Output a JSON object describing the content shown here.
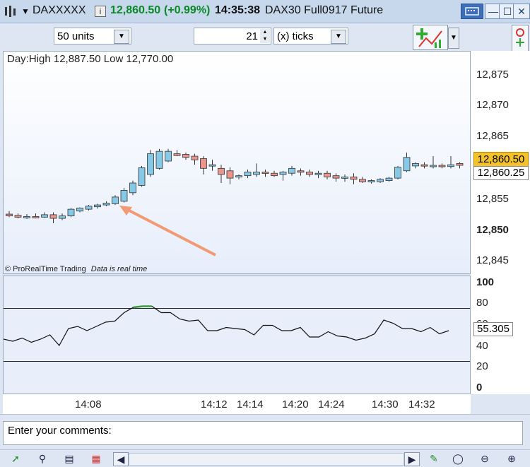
{
  "title": {
    "symbol": "DAXXXXX",
    "price": "12,860.50",
    "change": "(+0.99%)",
    "time": "14:35:38",
    "instrument": "DAX30 Full0917 Future",
    "info_glyph": "i",
    "minimize_glyph": "—",
    "maximize_glyph": "☐",
    "close_glyph": "✕",
    "keyboard_icon": "keyboard-icon"
  },
  "toolbar": {
    "units_value": "50 units",
    "ticks_value": "21",
    "ticks_unit": "(x) ticks"
  },
  "chart": {
    "header": "Day:High 12,887.50 Low 12,770.00",
    "credit": "© ProRealTime Trading",
    "credit_note": "Data is real time",
    "y_ticks": [
      "12,875",
      "12,870",
      "12,865",
      "12,860",
      "12,855",
      "12,850",
      "12,845"
    ],
    "price_badge": "12,860.50",
    "price_badge2": "12,860.25",
    "candle_up_color": "#86c9e6",
    "candle_down_color": "#e8958c",
    "arrow_color": "#f29a74"
  },
  "rsi": {
    "y_ticks": [
      "100",
      "80",
      "60",
      "40",
      "20",
      "0"
    ],
    "value_badge": "55.305"
  },
  "x_ticks": [
    "14:08",
    "14:12",
    "14:14",
    "14:20",
    "14:24",
    "14:30",
    "14:32"
  ],
  "comments": {
    "placeholder": "Enter your comments:"
  },
  "chart_data": {
    "type": "candlestick",
    "ohlc": [
      {
        "o": 12852.5,
        "h": 12853.0,
        "l": 12852.0,
        "c": 12852.2
      },
      {
        "o": 12852.3,
        "h": 12852.6,
        "l": 12851.8,
        "c": 12852.0
      },
      {
        "o": 12852.0,
        "h": 12852.5,
        "l": 12851.7,
        "c": 12852.1
      },
      {
        "o": 12852.1,
        "h": 12852.6,
        "l": 12851.8,
        "c": 12852.0
      },
      {
        "o": 12852.0,
        "h": 12852.8,
        "l": 12851.9,
        "c": 12852.4
      },
      {
        "o": 12852.4,
        "h": 12852.8,
        "l": 12851.0,
        "c": 12851.8
      },
      {
        "o": 12851.8,
        "h": 12852.6,
        "l": 12851.5,
        "c": 12852.2
      },
      {
        "o": 12852.2,
        "h": 12853.5,
        "l": 12852.0,
        "c": 12853.3
      },
      {
        "o": 12853.0,
        "h": 12853.6,
        "l": 12852.8,
        "c": 12853.5
      },
      {
        "o": 12853.3,
        "h": 12854.0,
        "l": 12853.1,
        "c": 12853.8
      },
      {
        "o": 12853.7,
        "h": 12854.2,
        "l": 12853.4,
        "c": 12854.0
      },
      {
        "o": 12854.0,
        "h": 12854.6,
        "l": 12853.8,
        "c": 12854.3
      },
      {
        "o": 12854.2,
        "h": 12855.6,
        "l": 12854.0,
        "c": 12855.3
      },
      {
        "o": 12854.6,
        "h": 12856.8,
        "l": 12854.4,
        "c": 12856.4
      },
      {
        "o": 12856.0,
        "h": 12858.0,
        "l": 12855.6,
        "c": 12857.6
      },
      {
        "o": 12857.2,
        "h": 12860.4,
        "l": 12857.0,
        "c": 12860.1
      },
      {
        "o": 12859.0,
        "h": 12863.0,
        "l": 12858.6,
        "c": 12862.4
      },
      {
        "o": 12860.0,
        "h": 12863.2,
        "l": 12859.8,
        "c": 12862.8
      },
      {
        "o": 12861.2,
        "h": 12863.2,
        "l": 12861.0,
        "c": 12862.8
      },
      {
        "o": 12862.4,
        "h": 12863.0,
        "l": 12862.0,
        "c": 12862.1
      },
      {
        "o": 12862.3,
        "h": 12862.6,
        "l": 12861.4,
        "c": 12861.8
      },
      {
        "o": 12862.0,
        "h": 12862.4,
        "l": 12860.6,
        "c": 12861.4
      },
      {
        "o": 12861.6,
        "h": 12862.0,
        "l": 12859.0,
        "c": 12860.0
      },
      {
        "o": 12860.4,
        "h": 12861.4,
        "l": 12859.6,
        "c": 12860.6
      },
      {
        "o": 12860.0,
        "h": 12860.6,
        "l": 12857.6,
        "c": 12859.0
      },
      {
        "o": 12859.6,
        "h": 12860.2,
        "l": 12857.4,
        "c": 12858.4
      },
      {
        "o": 12858.6,
        "h": 12859.0,
        "l": 12858.2,
        "c": 12858.8
      },
      {
        "o": 12858.8,
        "h": 12859.8,
        "l": 12858.4,
        "c": 12859.4
      },
      {
        "o": 12859.0,
        "h": 12860.8,
        "l": 12858.6,
        "c": 12859.4
      },
      {
        "o": 12859.4,
        "h": 12859.8,
        "l": 12858.6,
        "c": 12859.2
      },
      {
        "o": 12859.2,
        "h": 12859.6,
        "l": 12858.6,
        "c": 12858.8
      },
      {
        "o": 12859.0,
        "h": 12859.6,
        "l": 12858.0,
        "c": 12859.4
      },
      {
        "o": 12859.2,
        "h": 12860.4,
        "l": 12858.8,
        "c": 12860.0
      },
      {
        "o": 12859.6,
        "h": 12860.0,
        "l": 12858.8,
        "c": 12859.4
      },
      {
        "o": 12859.4,
        "h": 12859.8,
        "l": 12858.6,
        "c": 12859.0
      },
      {
        "o": 12859.0,
        "h": 12859.6,
        "l": 12858.4,
        "c": 12859.2
      },
      {
        "o": 12859.2,
        "h": 12859.6,
        "l": 12858.2,
        "c": 12858.6
      },
      {
        "o": 12858.8,
        "h": 12859.2,
        "l": 12857.8,
        "c": 12858.4
      },
      {
        "o": 12858.4,
        "h": 12859.0,
        "l": 12857.8,
        "c": 12858.6
      },
      {
        "o": 12858.6,
        "h": 12859.2,
        "l": 12857.4,
        "c": 12858.2
      },
      {
        "o": 12858.2,
        "h": 12858.6,
        "l": 12857.6,
        "c": 12857.8
      },
      {
        "o": 12857.8,
        "h": 12858.2,
        "l": 12857.5,
        "c": 12858.0
      },
      {
        "o": 12857.8,
        "h": 12858.4,
        "l": 12857.6,
        "c": 12858.2
      },
      {
        "o": 12858.0,
        "h": 12858.6,
        "l": 12857.8,
        "c": 12858.4
      },
      {
        "o": 12858.4,
        "h": 12860.4,
        "l": 12858.2,
        "c": 12860.2
      },
      {
        "o": 12859.6,
        "h": 12862.6,
        "l": 12859.4,
        "c": 12861.8
      },
      {
        "o": 12860.4,
        "h": 12861.0,
        "l": 12860.0,
        "c": 12860.8
      },
      {
        "o": 12860.6,
        "h": 12861.0,
        "l": 12860.0,
        "c": 12860.4
      },
      {
        "o": 12860.4,
        "h": 12862.0,
        "l": 12860.0,
        "c": 12860.5
      },
      {
        "o": 12860.5,
        "h": 12860.8,
        "l": 12860.0,
        "c": 12860.3
      },
      {
        "o": 12860.3,
        "h": 12862.0,
        "l": 12860.0,
        "c": 12860.6
      },
      {
        "o": 12860.8,
        "h": 12861.0,
        "l": 12860.0,
        "c": 12860.5
      }
    ],
    "rsi": [
      46,
      44,
      47,
      43,
      46,
      50,
      40,
      56,
      58,
      54,
      58,
      62,
      63,
      71,
      76,
      77,
      77,
      71,
      71,
      65,
      63,
      64,
      54,
      54,
      57,
      56,
      55,
      50,
      59,
      59,
      54,
      54,
      57,
      48,
      48,
      53,
      49,
      48,
      45,
      47,
      51,
      64,
      61,
      56,
      56,
      53,
      57,
      51,
      54
    ],
    "rsi_levels": [
      75,
      25
    ]
  }
}
